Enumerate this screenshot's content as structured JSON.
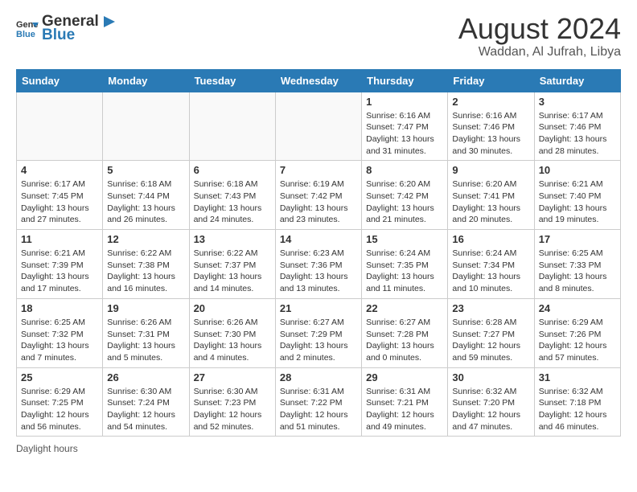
{
  "logo": {
    "text_general": "General",
    "text_blue": "Blue"
  },
  "title": "August 2024",
  "subtitle": "Waddan, Al Jufrah, Libya",
  "days_of_week": [
    "Sunday",
    "Monday",
    "Tuesday",
    "Wednesday",
    "Thursday",
    "Friday",
    "Saturday"
  ],
  "weeks": [
    [
      {
        "day": "",
        "info": ""
      },
      {
        "day": "",
        "info": ""
      },
      {
        "day": "",
        "info": ""
      },
      {
        "day": "",
        "info": ""
      },
      {
        "day": "1",
        "info": "Sunrise: 6:16 AM\nSunset: 7:47 PM\nDaylight: 13 hours and 31 minutes."
      },
      {
        "day": "2",
        "info": "Sunrise: 6:16 AM\nSunset: 7:46 PM\nDaylight: 13 hours and 30 minutes."
      },
      {
        "day": "3",
        "info": "Sunrise: 6:17 AM\nSunset: 7:46 PM\nDaylight: 13 hours and 28 minutes."
      }
    ],
    [
      {
        "day": "4",
        "info": "Sunrise: 6:17 AM\nSunset: 7:45 PM\nDaylight: 13 hours and 27 minutes."
      },
      {
        "day": "5",
        "info": "Sunrise: 6:18 AM\nSunset: 7:44 PM\nDaylight: 13 hours and 26 minutes."
      },
      {
        "day": "6",
        "info": "Sunrise: 6:18 AM\nSunset: 7:43 PM\nDaylight: 13 hours and 24 minutes."
      },
      {
        "day": "7",
        "info": "Sunrise: 6:19 AM\nSunset: 7:42 PM\nDaylight: 13 hours and 23 minutes."
      },
      {
        "day": "8",
        "info": "Sunrise: 6:20 AM\nSunset: 7:42 PM\nDaylight: 13 hours and 21 minutes."
      },
      {
        "day": "9",
        "info": "Sunrise: 6:20 AM\nSunset: 7:41 PM\nDaylight: 13 hours and 20 minutes."
      },
      {
        "day": "10",
        "info": "Sunrise: 6:21 AM\nSunset: 7:40 PM\nDaylight: 13 hours and 19 minutes."
      }
    ],
    [
      {
        "day": "11",
        "info": "Sunrise: 6:21 AM\nSunset: 7:39 PM\nDaylight: 13 hours and 17 minutes."
      },
      {
        "day": "12",
        "info": "Sunrise: 6:22 AM\nSunset: 7:38 PM\nDaylight: 13 hours and 16 minutes."
      },
      {
        "day": "13",
        "info": "Sunrise: 6:22 AM\nSunset: 7:37 PM\nDaylight: 13 hours and 14 minutes."
      },
      {
        "day": "14",
        "info": "Sunrise: 6:23 AM\nSunset: 7:36 PM\nDaylight: 13 hours and 13 minutes."
      },
      {
        "day": "15",
        "info": "Sunrise: 6:24 AM\nSunset: 7:35 PM\nDaylight: 13 hours and 11 minutes."
      },
      {
        "day": "16",
        "info": "Sunrise: 6:24 AM\nSunset: 7:34 PM\nDaylight: 13 hours and 10 minutes."
      },
      {
        "day": "17",
        "info": "Sunrise: 6:25 AM\nSunset: 7:33 PM\nDaylight: 13 hours and 8 minutes."
      }
    ],
    [
      {
        "day": "18",
        "info": "Sunrise: 6:25 AM\nSunset: 7:32 PM\nDaylight: 13 hours and 7 minutes."
      },
      {
        "day": "19",
        "info": "Sunrise: 6:26 AM\nSunset: 7:31 PM\nDaylight: 13 hours and 5 minutes."
      },
      {
        "day": "20",
        "info": "Sunrise: 6:26 AM\nSunset: 7:30 PM\nDaylight: 13 hours and 4 minutes."
      },
      {
        "day": "21",
        "info": "Sunrise: 6:27 AM\nSunset: 7:29 PM\nDaylight: 13 hours and 2 minutes."
      },
      {
        "day": "22",
        "info": "Sunrise: 6:27 AM\nSunset: 7:28 PM\nDaylight: 13 hours and 0 minutes."
      },
      {
        "day": "23",
        "info": "Sunrise: 6:28 AM\nSunset: 7:27 PM\nDaylight: 12 hours and 59 minutes."
      },
      {
        "day": "24",
        "info": "Sunrise: 6:29 AM\nSunset: 7:26 PM\nDaylight: 12 hours and 57 minutes."
      }
    ],
    [
      {
        "day": "25",
        "info": "Sunrise: 6:29 AM\nSunset: 7:25 PM\nDaylight: 12 hours and 56 minutes."
      },
      {
        "day": "26",
        "info": "Sunrise: 6:30 AM\nSunset: 7:24 PM\nDaylight: 12 hours and 54 minutes."
      },
      {
        "day": "27",
        "info": "Sunrise: 6:30 AM\nSunset: 7:23 PM\nDaylight: 12 hours and 52 minutes."
      },
      {
        "day": "28",
        "info": "Sunrise: 6:31 AM\nSunset: 7:22 PM\nDaylight: 12 hours and 51 minutes."
      },
      {
        "day": "29",
        "info": "Sunrise: 6:31 AM\nSunset: 7:21 PM\nDaylight: 12 hours and 49 minutes."
      },
      {
        "day": "30",
        "info": "Sunrise: 6:32 AM\nSunset: 7:20 PM\nDaylight: 12 hours and 47 minutes."
      },
      {
        "day": "31",
        "info": "Sunrise: 6:32 AM\nSunset: 7:18 PM\nDaylight: 12 hours and 46 minutes."
      }
    ]
  ],
  "footer": "Daylight hours"
}
